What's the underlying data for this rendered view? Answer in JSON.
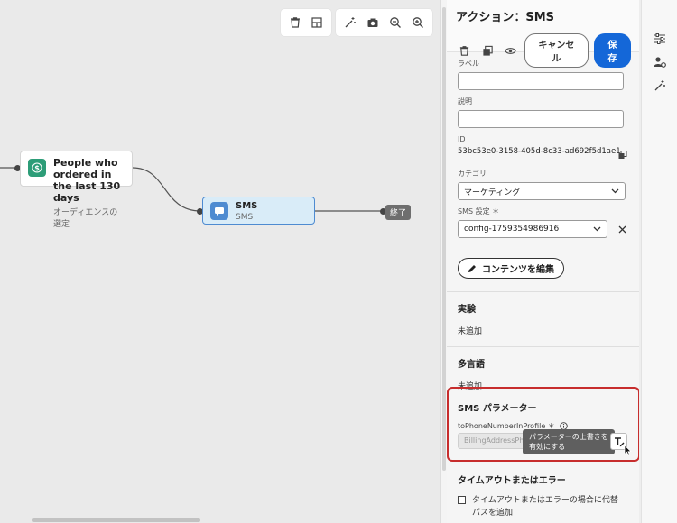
{
  "canvas": {
    "nodes": {
      "audience": {
        "title_line1": "People who ordered in",
        "title_line2": "the last 130 days",
        "subtitle": "オーディエンスの選定"
      },
      "sms": {
        "title": "SMS",
        "subtitle": "SMS"
      },
      "end_label": "終了"
    },
    "toolbar_icons": [
      "trash-icon",
      "fit-view-icon",
      "magic-wand-icon",
      "camera-icon",
      "zoom-out-icon",
      "zoom-in-icon"
    ]
  },
  "panel": {
    "title": "アクション：SMS",
    "cancel_label": "キャンセル",
    "save_label": "保存",
    "label_field": {
      "label": "ラベル",
      "value": ""
    },
    "description_field": {
      "label": "説明",
      "value": ""
    },
    "id_field": {
      "label": "ID",
      "value": "53bc53e0-3158-405d-8c33-ad692f5d1ae1"
    },
    "category_field": {
      "label": "カテゴリ",
      "value": "マーケティング"
    },
    "sms_config_field": {
      "label": "SMS 設定 ＊",
      "value": "config-1759354986916"
    },
    "edit_content_label": "コンテンツを編集",
    "experiment": {
      "title": "実験",
      "value": "未追加"
    },
    "multilingual": {
      "title": "多言語",
      "value": "未追加"
    },
    "sms_params": {
      "title": "SMS パラメーター",
      "param_label": "toPhoneNumberInProfile ＊",
      "param_placeholder": "BillingAddressPhone",
      "tooltip_line1": "パラメーターの上書きを",
      "tooltip_line2": "有効にする"
    },
    "timeout": {
      "title": "タイムアウトまたはエラー",
      "checkbox_line1": "タイムアウトまたはエラーの場合に代替",
      "checkbox_line2": "パスを追加"
    }
  },
  "colors": {
    "accent": "#1467d8",
    "highlight": "#c72d2d",
    "selected_node": "#d9ecf8"
  }
}
